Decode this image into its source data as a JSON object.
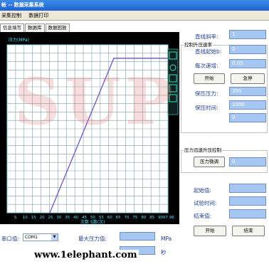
{
  "window": {
    "title": "帐 -- 数据采集系统"
  },
  "menu": {
    "items": [
      "采集控制",
      "数据打印"
    ]
  },
  "tabs": [
    "信息填写",
    "数据库",
    "数据回放"
  ],
  "chart_data": {
    "type": "line",
    "title": "压力(MPa)",
    "xlabel": "次数 S数(次)",
    "x_ticks": [
      "5",
      "10",
      "15",
      "20",
      "25",
      "30",
      "35",
      "40",
      "45",
      "50",
      "55",
      "60",
      "65",
      "70",
      "75",
      "80",
      "85",
      "90",
      "97.96"
    ],
    "series": [
      {
        "values": [
          [
            26,
            0
          ],
          [
            65,
            92
          ],
          [
            97.96,
            92
          ]
        ]
      }
    ],
    "xlim": [
      0,
      97.96
    ],
    "ylim": [
      0,
      100
    ],
    "grid": true,
    "line_color": "#7b5ec6",
    "grid_color": "#7ca1a8",
    "axis_color": "#8dd3e0"
  },
  "right_panel": {
    "group1_title": "控制升压速率",
    "slope_label": "直线斜率:",
    "slope_value": "1",
    "start_label": "直线起始b:",
    "start_value": "0",
    "increment_label": "每次递增:",
    "increment_value": "0.05",
    "start_button": "开始",
    "stop_button": "急停",
    "hold_pressure_label": "保压压力:",
    "hold_pressure_value": "300",
    "hold_time_label": "保压时间:",
    "hold_time_value": "1000",
    "extra_value": "0",
    "group2_title": "压力迅速升压控制",
    "fine_tune_button": "压力微调",
    "fine_tune_value": "0",
    "initial_label": "起始值:",
    "test_time_label": "试验时间:",
    "end_label": "结束值:",
    "start_button2": "开始",
    "end_button": "结束"
  },
  "bottom": {
    "port_label": "串口值:",
    "port_value": "COM1",
    "max_pressure_label": "最大压力值:",
    "max_pressure_unit": "MPa",
    "seconds_unit": "秒"
  },
  "watermark": "SUP",
  "website": "www.1elephant.com"
}
